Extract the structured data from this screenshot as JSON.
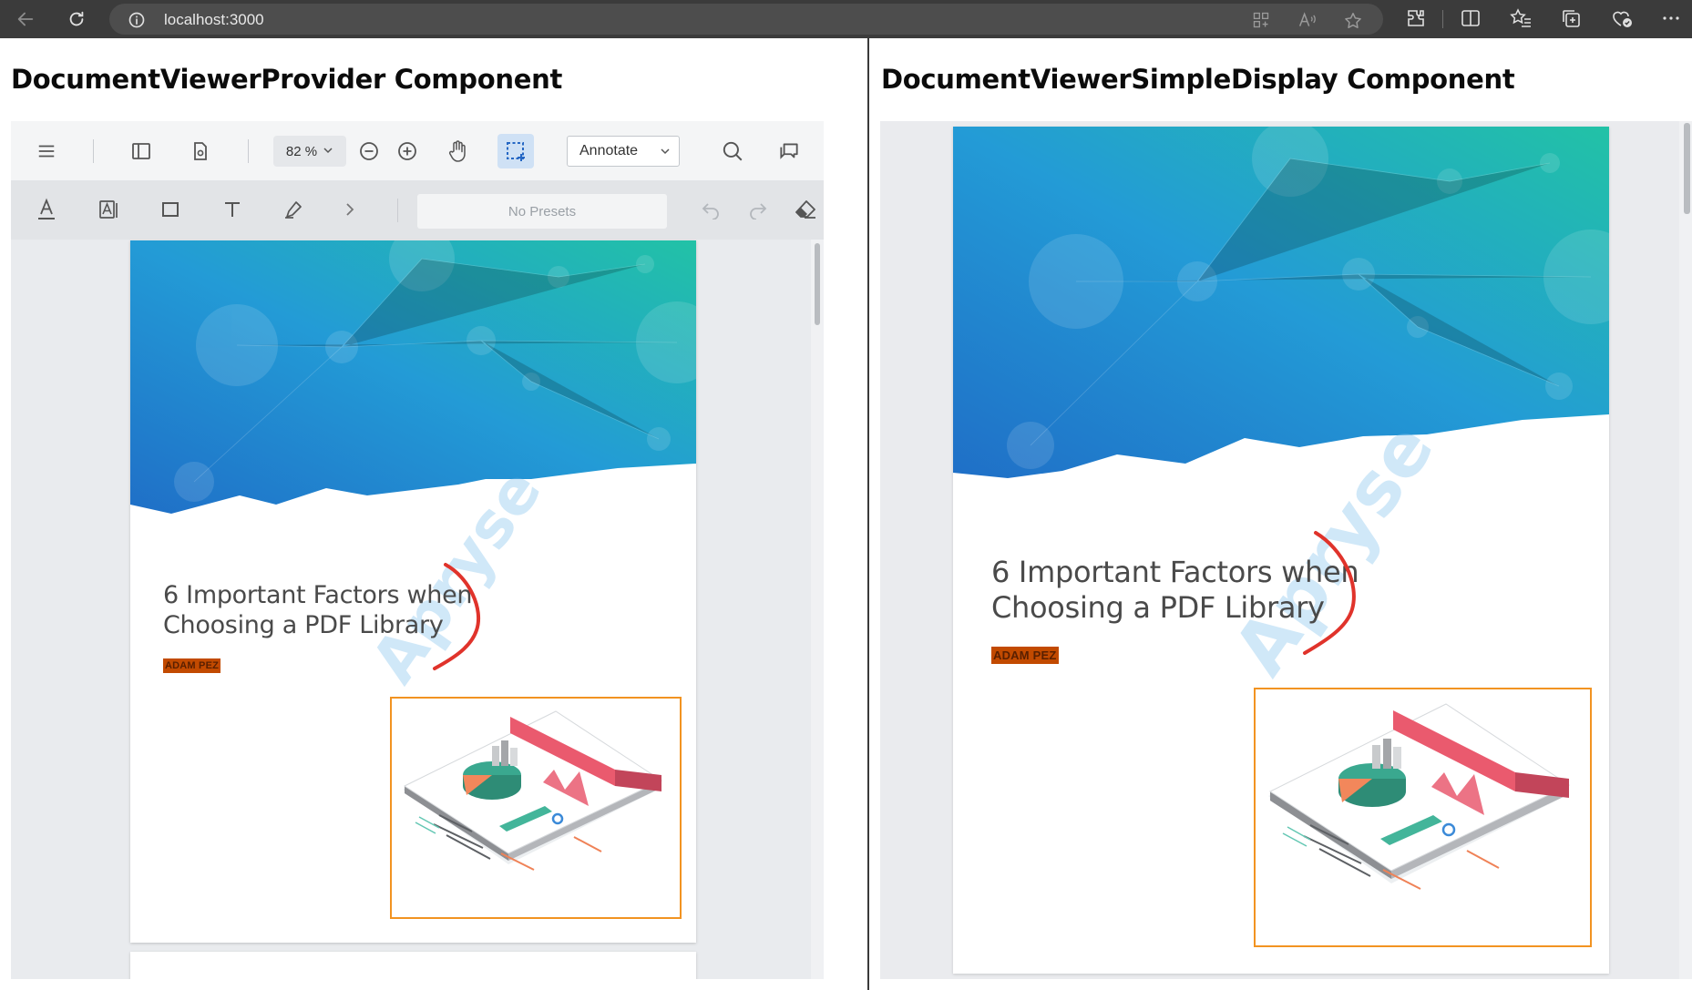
{
  "browser": {
    "url": "localhost:3000",
    "icons": [
      "back-arrow-icon",
      "refresh-icon",
      "info-icon",
      "app-grid-icon",
      "read-aloud-icon",
      "favorite-star-icon",
      "extensions-icon",
      "split-screen-icon",
      "favorites-icon",
      "collections-icon",
      "performance-icon",
      "more-icon"
    ]
  },
  "left_pane": {
    "title": "DocumentViewerProvider Component",
    "toolbar": {
      "zoom_value": "82 %",
      "mode_value": "Annotate",
      "presets_placeholder": "No Presets",
      "active_tool": "marquee-select"
    }
  },
  "right_pane": {
    "title": "DocumentViewerSimpleDisplay Component"
  },
  "document": {
    "title_line1": "6 Important Factors when",
    "title_line2": "Choosing a PDF Library",
    "author": "ADAM PEZ",
    "watermark": "Apryse"
  },
  "colors": {
    "accent_orange": "#f29321",
    "highlight": "#c24a00",
    "ink_red": "#e0332b",
    "active_tool_bg": "#cfe1f5"
  }
}
